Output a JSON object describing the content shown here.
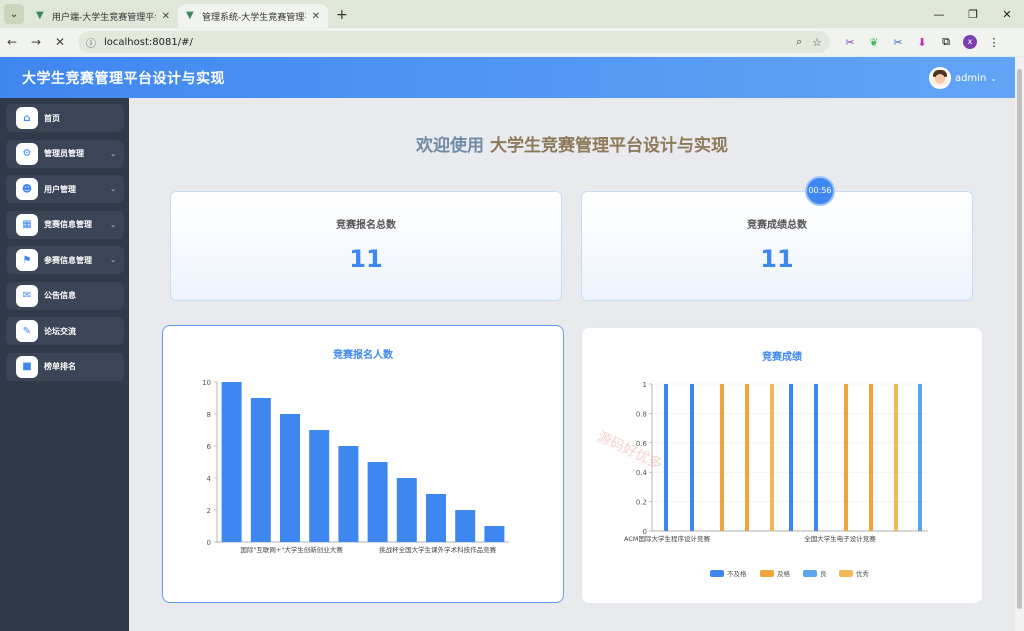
{
  "browser": {
    "tabs": [
      {
        "title": "用户端-大学生竞赛管理平台设计"
      },
      {
        "title": "管理系统-大学生竞赛管理平台设"
      }
    ],
    "url": "localhost:8081/#/"
  },
  "header": {
    "app_title": "大学生竞赛管理平台设计与实现",
    "username": "admin"
  },
  "sidebar": {
    "items": [
      {
        "label": "首页",
        "icon": "home-icon",
        "expandable": false
      },
      {
        "label": "管理员管理",
        "icon": "admin-icon",
        "expandable": true
      },
      {
        "label": "用户管理",
        "icon": "user-icon",
        "expandable": true
      },
      {
        "label": "竞赛信息管理",
        "icon": "grid-icon",
        "expandable": true
      },
      {
        "label": "参赛信息管理",
        "icon": "participant-icon",
        "expandable": true
      },
      {
        "label": "公告信息",
        "icon": "notice-icon",
        "expandable": false
      },
      {
        "label": "论坛交流",
        "icon": "forum-icon",
        "expandable": false
      },
      {
        "label": "榜单排名",
        "icon": "ranking-icon",
        "expandable": false
      }
    ]
  },
  "main": {
    "welcome_prefix": "欢迎使用",
    "welcome_title": "大学生竞赛管理平台设计与实现",
    "timer": "00:56",
    "stats": [
      {
        "label": "竞赛报名总数",
        "value": "11"
      },
      {
        "label": "竞赛成绩总数",
        "value": "11"
      }
    ]
  },
  "watermark": "源码好优多",
  "colors": {
    "accent": "#3f87f0",
    "sidebar": "#2f3a4a"
  },
  "chart_data": [
    {
      "type": "bar",
      "title": "竞赛报名人数",
      "categories": [
        "国际\"互联网+\"大学生创新创业大赛",
        "",
        "",
        "",
        "",
        "挑战杯全国大学生课外学术科技作品竞赛",
        "",
        "",
        "",
        ""
      ],
      "values": [
        10,
        9,
        8,
        7,
        6,
        5,
        4,
        3,
        2,
        1
      ],
      "ylim": [
        0,
        10
      ],
      "yticks": [
        0,
        2,
        4,
        6,
        8,
        10
      ],
      "color": "#3f87f0"
    },
    {
      "type": "bar",
      "title": "竞赛成绩",
      "categories": [
        "ACM国际大学生程序设计竞赛",
        "全国大学生电子设计竞赛"
      ],
      "ylim": [
        0,
        1
      ],
      "yticks": [
        "0",
        "0.2",
        "0.4",
        "0.6",
        "0.8",
        "1"
      ],
      "series": [
        {
          "name": "不及格",
          "color": "#3f87f0",
          "values": [
            1,
            1
          ]
        },
        {
          "name": "及格",
          "color": "#f0a53c",
          "values": [
            1,
            1
          ]
        },
        {
          "name": "良",
          "color": "#5aa7f0",
          "values": [
            1,
            1
          ]
        },
        {
          "name": "优秀",
          "color": "#f2b857",
          "values": [
            1,
            1
          ]
        }
      ]
    }
  ]
}
